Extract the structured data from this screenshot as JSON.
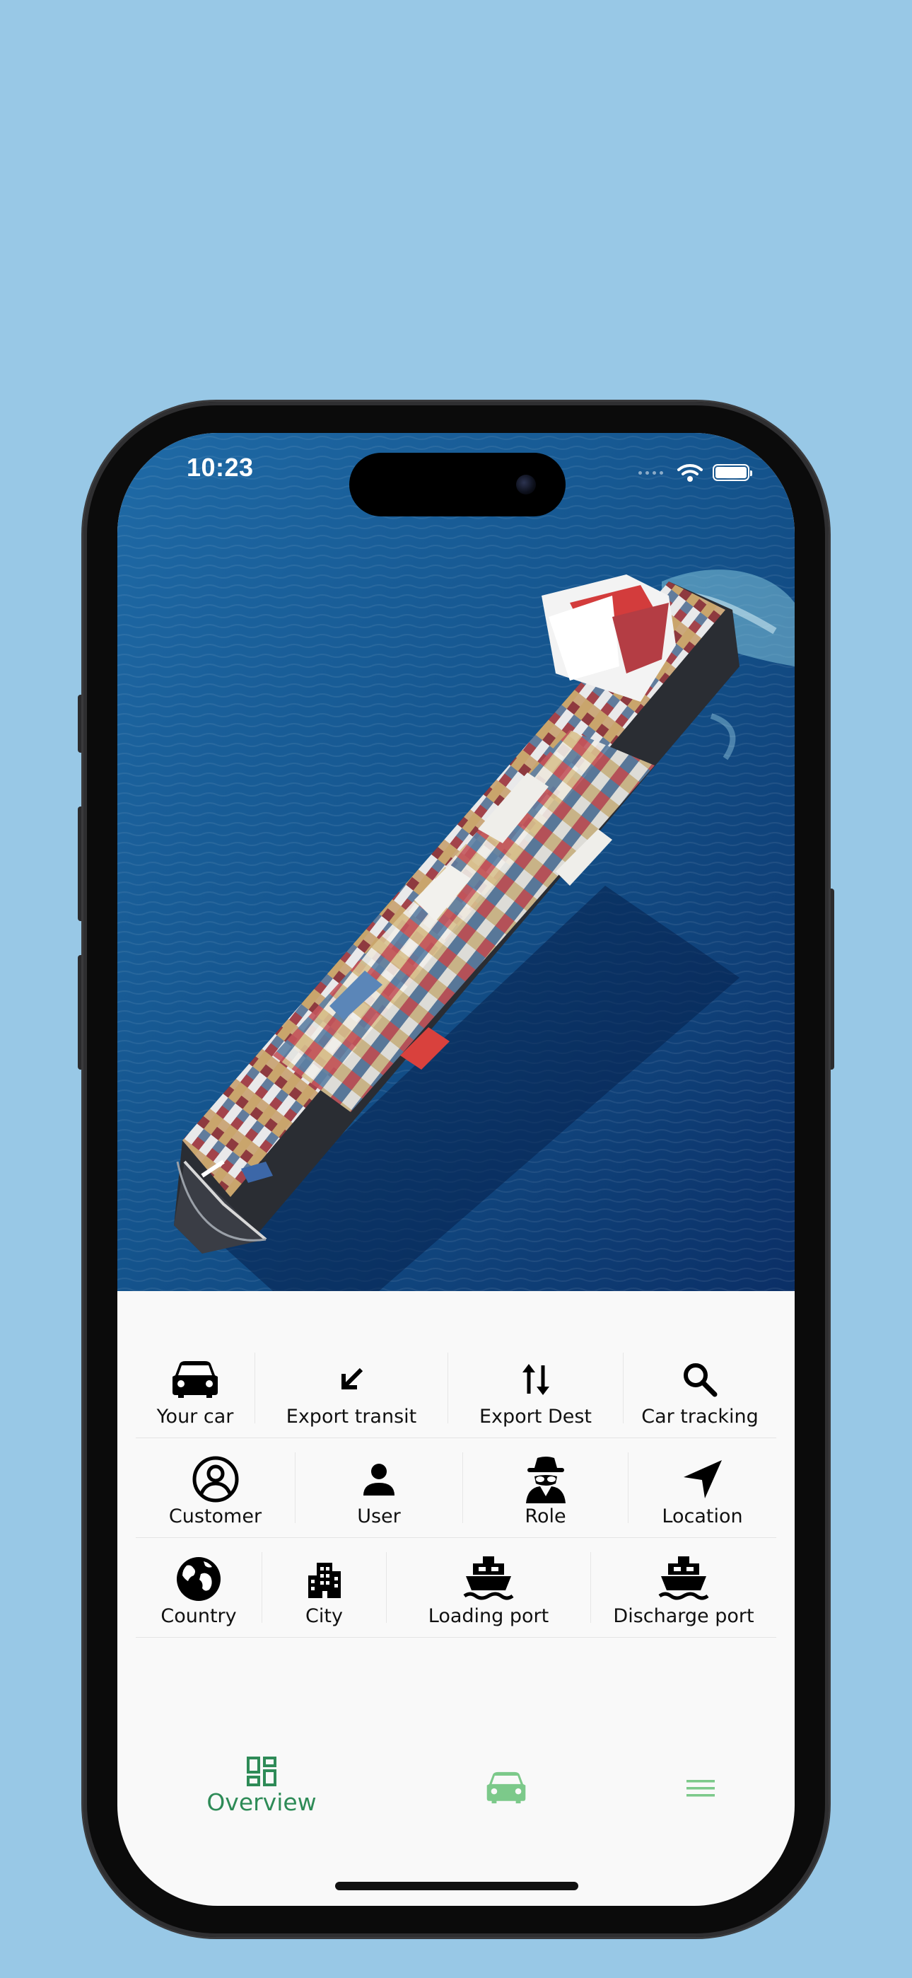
{
  "status_bar": {
    "time": "10:23"
  },
  "menu": {
    "rows": [
      [
        {
          "label": "Your car",
          "icon": "car-icon"
        },
        {
          "label": "Export transit",
          "icon": "arrow-down-left-icon"
        },
        {
          "label": "Export Dest",
          "icon": "swap-vertical-icon"
        },
        {
          "label": "Car tracking",
          "icon": "search-icon"
        }
      ],
      [
        {
          "label": "Customer",
          "icon": "account-circle-icon"
        },
        {
          "label": "User",
          "icon": "person-icon"
        },
        {
          "label": "Role",
          "icon": "spy-icon"
        },
        {
          "label": "Location",
          "icon": "navigation-arrow-icon"
        }
      ],
      [
        {
          "label": "Country",
          "icon": "globe-icon"
        },
        {
          "label": "City",
          "icon": "city-icon"
        },
        {
          "label": "Loading port",
          "icon": "ship-icon"
        },
        {
          "label": "Discharge port",
          "icon": "ship-icon"
        }
      ]
    ]
  },
  "tab_bar": {
    "overview_label": "Overview",
    "active_tab": "Overview",
    "accent_color": "#2e8b57",
    "inactive_color": "#7cc98a"
  },
  "background_color": "#98c8e6"
}
